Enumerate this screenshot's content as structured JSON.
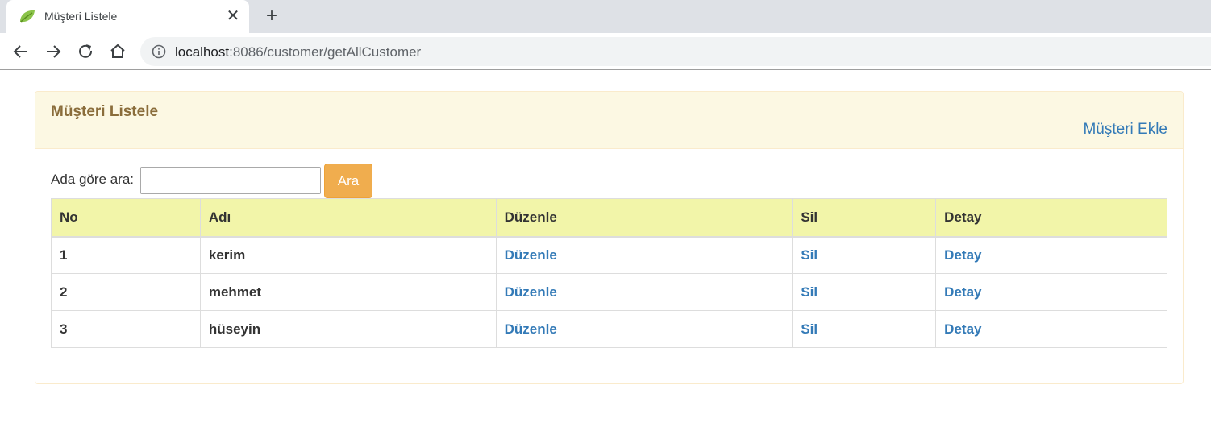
{
  "browser": {
    "tab_title": "Müşteri Listele",
    "url_host": "localhost",
    "url_rest": ":8086/customer/getAllCustomer"
  },
  "panel": {
    "title": "Müşteri Listele",
    "add_link": "Müşteri Ekle"
  },
  "search": {
    "label": "Ada göre ara:",
    "value": "",
    "button": "Ara"
  },
  "table": {
    "headers": [
      "No",
      "Adı",
      "Düzenle",
      "Sil",
      "Detay"
    ],
    "rows": [
      {
        "no": "1",
        "name": "kerim",
        "edit": "Düzenle",
        "delete": "Sil",
        "detail": "Detay"
      },
      {
        "no": "2",
        "name": "mehmet",
        "edit": "Düzenle",
        "delete": "Sil",
        "detail": "Detay"
      },
      {
        "no": "3",
        "name": "hüseyin",
        "edit": "Düzenle",
        "delete": "Sil",
        "detail": "Detay"
      }
    ]
  },
  "colors": {
    "heading_bg": "#fcf8e3",
    "heading_text": "#8a6d3b",
    "link": "#337ab7",
    "button": "#f0ad4e",
    "table_header_bg": "#f2f5a9"
  }
}
